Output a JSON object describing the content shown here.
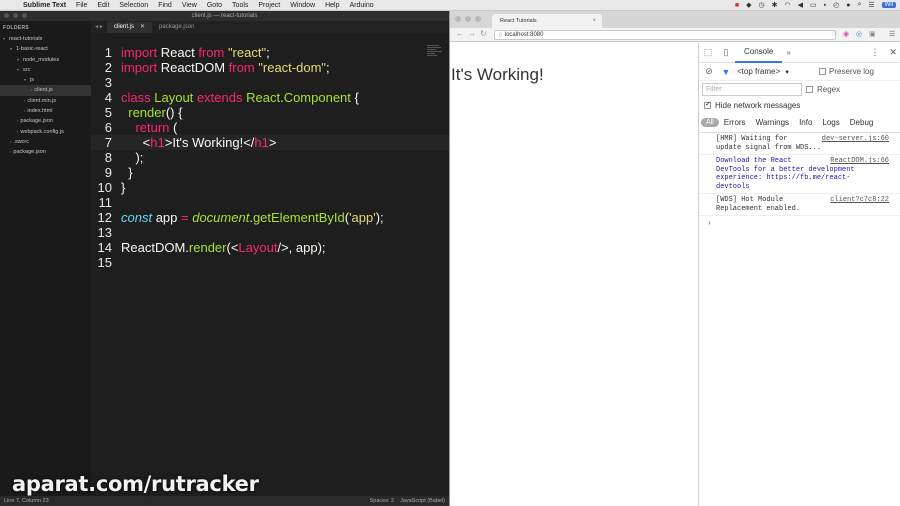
{
  "menubar": {
    "apple": "",
    "app": "Sublime Text",
    "items": [
      "File",
      "Edit",
      "Selection",
      "Find",
      "View",
      "Goto",
      "Tools",
      "Project",
      "Window",
      "Help",
      "Arduino"
    ],
    "user": "Wil"
  },
  "sublime": {
    "window_title": "client.js — react-tutorials",
    "sidebar": {
      "heading": "FOLDERS",
      "items": [
        {
          "label": "react-tutorials",
          "depth": 0,
          "type": "folder"
        },
        {
          "label": "1-basic-react",
          "depth": 1,
          "type": "folder"
        },
        {
          "label": "node_modules",
          "depth": 2,
          "type": "folder"
        },
        {
          "label": "src",
          "depth": 2,
          "type": "folder"
        },
        {
          "label": "js",
          "depth": 3,
          "type": "folder"
        },
        {
          "label": "client.js",
          "depth": 4,
          "type": "file",
          "selected": true
        },
        {
          "label": "client.min.js",
          "depth": 3,
          "type": "file"
        },
        {
          "label": "index.html",
          "depth": 3,
          "type": "file"
        },
        {
          "label": "package.json",
          "depth": 2,
          "type": "file"
        },
        {
          "label": "webpack.config.js",
          "depth": 2,
          "type": "file"
        },
        {
          "label": ".swcrc",
          "depth": 1,
          "type": "file"
        },
        {
          "label": "package.json",
          "depth": 1,
          "type": "file"
        }
      ]
    },
    "tabs": [
      {
        "label": "client.js",
        "active": true
      },
      {
        "label": "package.json",
        "active": false
      }
    ],
    "line_numbers": [
      "1",
      "2",
      "3",
      "4",
      "5",
      "6",
      "7",
      "8",
      "9",
      "10",
      "11",
      "12",
      "13",
      "14",
      "15"
    ],
    "status_left": "Line 7, Column 23",
    "status_spaces": "Spaces: 2",
    "status_syntax": "JavaScript (Babel)"
  },
  "watermark": "aparat.com/rutracker",
  "chrome": {
    "tab_title": "React Tutorials",
    "url": "localhost:8080",
    "page_heading": "It's Working!"
  },
  "devtools": {
    "console_tab": "Console",
    "more": "»",
    "frame": "<top frame>",
    "preserve_log": "Preserve log",
    "filter_placeholder": "Filter",
    "regex": "Regex",
    "hide_network": "Hide network messages",
    "levels": [
      "All",
      "Errors",
      "Warnings",
      "Info",
      "Logs",
      "Debug"
    ],
    "messages": [
      {
        "text": "[HMR] Waiting for\nupdate signal from WDS...",
        "source": "dev-server.js:60",
        "kind": "log"
      },
      {
        "text": "Download the React\nDevTools for a better development\nexperience: https://fb.me/react-\ndevtools",
        "source": "ReactDOM.js:66",
        "kind": "info"
      },
      {
        "text": "[WDS] Hot Module\nReplacement enabled.",
        "source": "client?c7c8:22",
        "kind": "log"
      }
    ],
    "prompt": "›"
  }
}
